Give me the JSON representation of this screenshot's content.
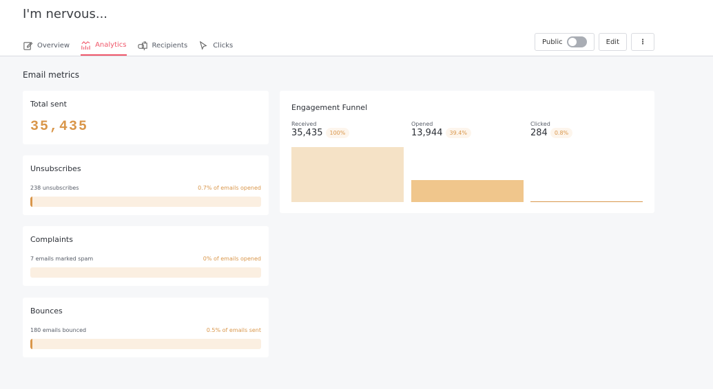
{
  "header": {
    "title": "I'm nervous...",
    "tabs": [
      {
        "label": "Overview",
        "icon": "edit-icon"
      },
      {
        "label": "Analytics",
        "icon": "analytics-icon",
        "active": true
      },
      {
        "label": "Recipients",
        "icon": "mailbox-icon"
      },
      {
        "label": "Clicks",
        "icon": "cursor-icon"
      }
    ],
    "public_label": "Public",
    "public_on": false,
    "edit_label": "Edit"
  },
  "section_title": "Email metrics",
  "total": {
    "title": "Total sent",
    "value": "35,435"
  },
  "metrics": [
    {
      "title": "Unsubscribes",
      "left": "238 unsubscribes",
      "right": "0.7% of emails opened",
      "fraction": 0.007
    },
    {
      "title": "Complaints",
      "left": "7 emails marked spam",
      "right": "0% of emails opened",
      "fraction": 0
    },
    {
      "title": "Bounces",
      "left": "180 emails bounced",
      "right": "0.5% of emails sent",
      "fraction": 0.005
    }
  ],
  "funnel": {
    "title": "Engagement Funnel",
    "steps": [
      {
        "label": "Received",
        "value": "35,435",
        "pct": "100%",
        "fraction": 1.0,
        "color": "#f5e2c6"
      },
      {
        "label": "Opened",
        "value": "13,944",
        "pct": "39.4%",
        "fraction": 0.394,
        "color": "#f0c68c"
      },
      {
        "label": "Clicked",
        "value": "284",
        "pct": "0.8%",
        "fraction": 0.008,
        "color": "#d9964a"
      }
    ]
  }
}
